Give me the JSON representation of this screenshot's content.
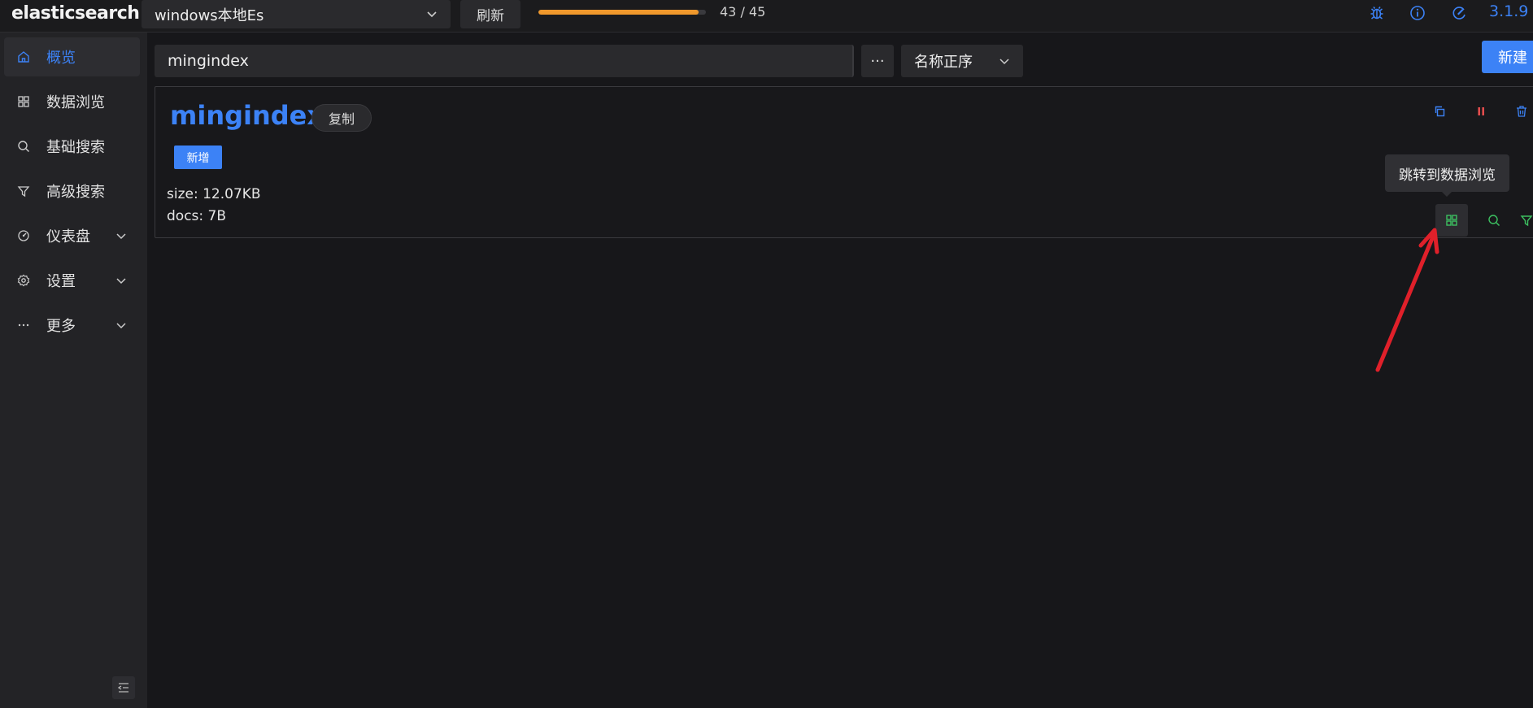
{
  "app": {
    "logo": "elasticsearch",
    "version": "3.1.9"
  },
  "topbar": {
    "cluster_name": "windows本地Es",
    "refresh_label": "刷新",
    "progress": {
      "current": 43,
      "total": 45,
      "text": "43 / 45"
    }
  },
  "sidebar": {
    "items": [
      {
        "label": "概览",
        "icon": "home-icon",
        "active": true
      },
      {
        "label": "数据浏览",
        "icon": "grid-icon"
      },
      {
        "label": "基础搜索",
        "icon": "search-icon"
      },
      {
        "label": "高级搜索",
        "icon": "filter-icon"
      },
      {
        "label": "仪表盘",
        "icon": "dashboard-icon",
        "expandable": true
      },
      {
        "label": "设置",
        "icon": "gear-icon",
        "expandable": true
      },
      {
        "label": "更多",
        "icon": "ellipsis-icon",
        "expandable": true
      }
    ]
  },
  "toolbar": {
    "search_value": "mingindex",
    "more_label": "···",
    "sort_value": "名称正序",
    "new_label": "新建"
  },
  "index_card": {
    "name": "mingindex",
    "copy_label": "复制",
    "add_label": "新增",
    "size": "size: 12.07KB",
    "docs": "docs: 7B",
    "tooltip": "跳转到数据浏览"
  },
  "colors": {
    "accent": "#3c82f6",
    "progress": "#f0982c",
    "danger": "#f05050",
    "success": "#3cc060",
    "annotation": "#e0202a"
  }
}
